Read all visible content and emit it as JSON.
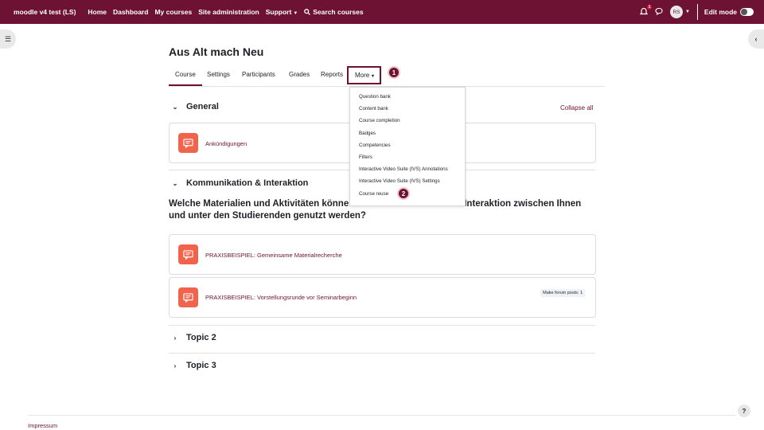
{
  "topbar": {
    "site_name": "moodle v4 test (LS)",
    "nav": [
      "Home",
      "Dashboard",
      "My courses",
      "Site administration",
      "Support"
    ],
    "search_label": "Search courses",
    "notification_count": "1",
    "avatar_initials": "RS",
    "edit_mode_label": "Edit mode",
    "edit_mode_on": false
  },
  "course": {
    "title": "Aus Alt mach Neu",
    "tabs": [
      "Course",
      "Settings",
      "Participants",
      "Grades",
      "Reports",
      "More"
    ],
    "active_tab": "Course"
  },
  "more_menu": {
    "items": [
      "Question bank",
      "Content bank",
      "Course completion",
      "Badges",
      "Competencies",
      "Filters",
      "Interactive Video Suite (IVS) Annotations",
      "Interactive Video Suite (IVS) Settings",
      "Course reuse"
    ]
  },
  "markers": [
    "1",
    "2"
  ],
  "sections": {
    "general": {
      "title": "General",
      "collapse_all": "Collapse all",
      "activities": [
        {
          "label": "Ankündigungen"
        }
      ]
    },
    "kommunikation": {
      "title": "Kommunikation & Interaktion",
      "question": "Welche Materialien und Aktivitäten können zur Kommunikation und Interaktion zwischen Ihnen und unter den Studierenden genutzt werden?",
      "activities": [
        {
          "label": "PRAXISBEISPIEL: Gemeinsame Materialrecherche"
        },
        {
          "label": "PRAXISBEISPIEL: Vorstellungsrunde vor Seminarbeginn",
          "completion": "Make forum posts: 1"
        }
      ]
    },
    "topic2": {
      "title": "Topic 2"
    },
    "topic3": {
      "title": "Topic 3"
    }
  },
  "footer": {
    "impressum": "Impressum",
    "help": "?"
  },
  "colors": {
    "brand": "#6d1232",
    "forum_icon": "#f1634b"
  }
}
